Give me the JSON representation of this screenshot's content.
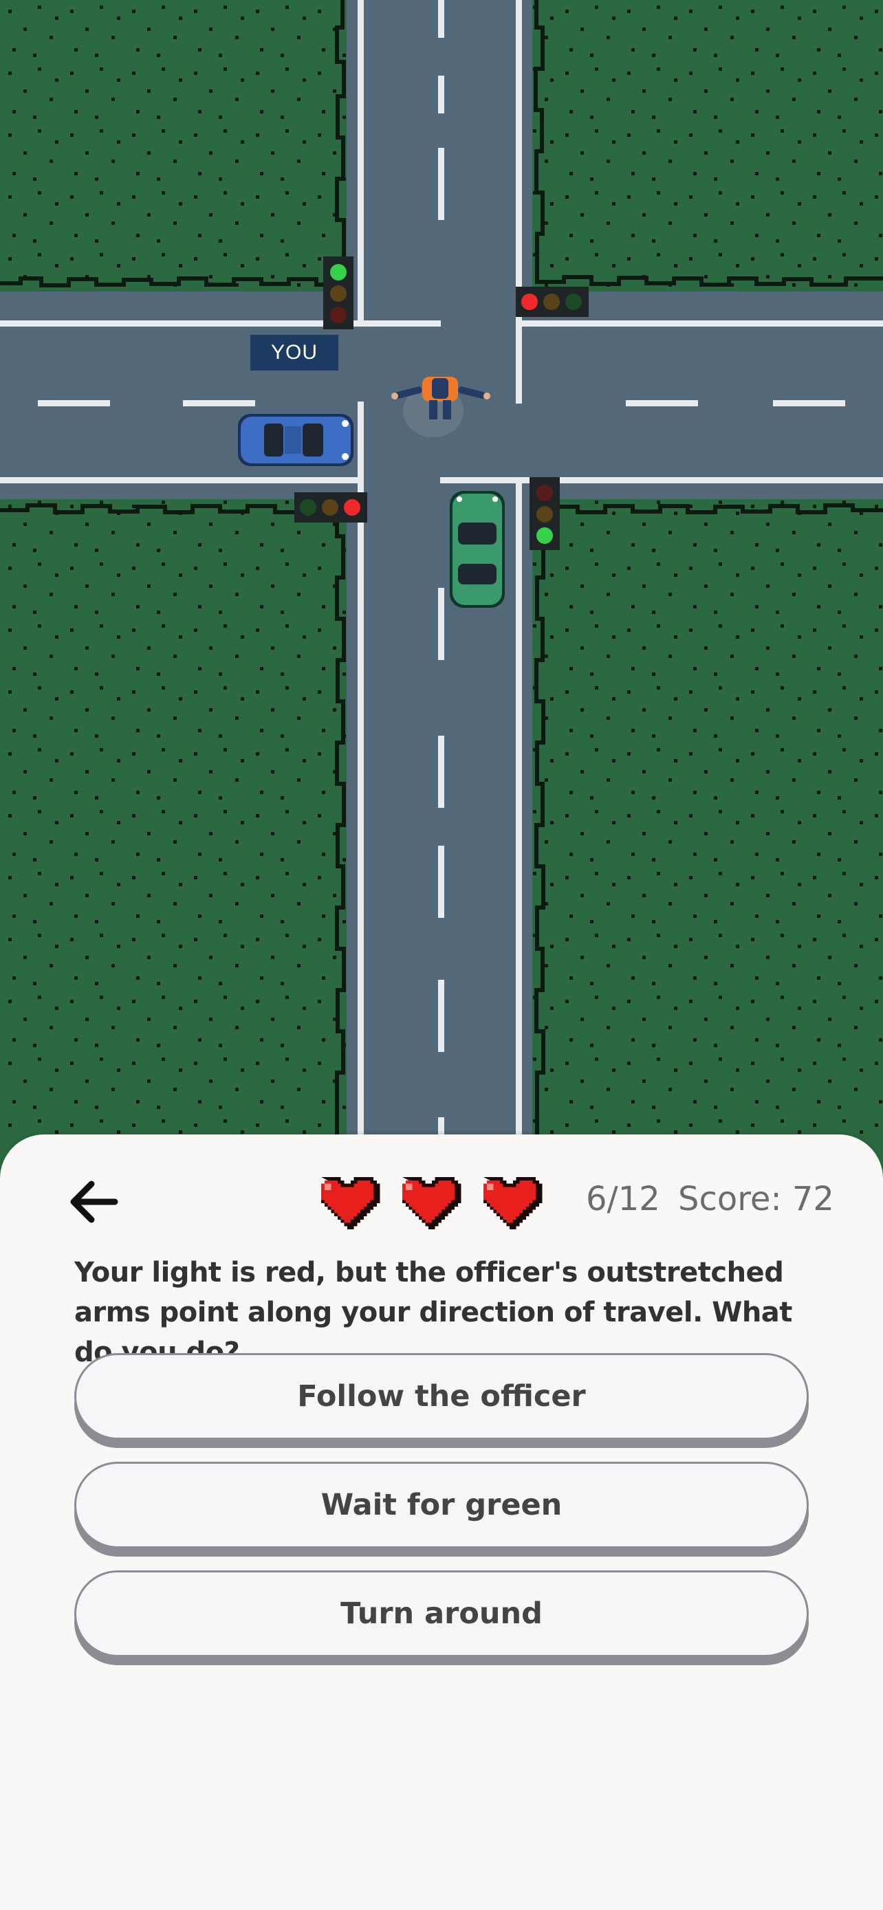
{
  "scene": {
    "you_label": "YOU",
    "colors": {
      "grass": "#2b6a40",
      "road": "#536878",
      "lane_mark": "#e8ecef",
      "player_car": "#3b6ec4",
      "other_car": "#3b9a6c",
      "officer_vest": "#f07a2a"
    },
    "signals": {
      "your_light": "red",
      "cross_light": "green"
    }
  },
  "hud": {
    "back_icon": "arrow-left-icon",
    "lives": 3,
    "heart_icon": "heart-icon",
    "progress": "6/12",
    "score": "Score: 72"
  },
  "question": {
    "text": "Your light is red, but the officer's outstretched arms point along your direction of travel. What do you do?"
  },
  "answers": [
    {
      "label": "Follow the officer"
    },
    {
      "label": "Wait for green"
    },
    {
      "label": "Turn around"
    }
  ]
}
